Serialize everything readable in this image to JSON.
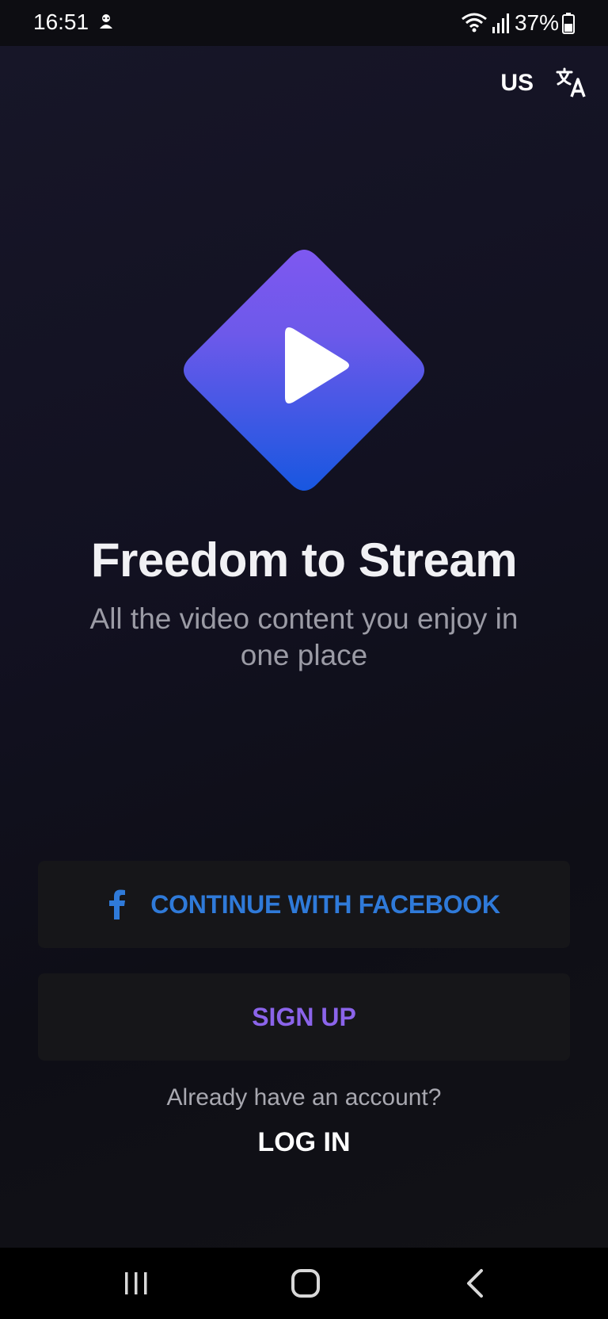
{
  "status_bar": {
    "time": "16:51",
    "battery": "37%"
  },
  "header": {
    "region": "US"
  },
  "hero": {
    "title": "Freedom to Stream",
    "subtitle": "All the video content you enjoy in one place"
  },
  "actions": {
    "facebook_label": "CONTINUE WITH FACEBOOK",
    "signup_label": "SIGN UP",
    "account_prompt": "Already have an account?",
    "login_label": "LOG IN"
  },
  "colors": {
    "facebook_blue": "#2f7ad9",
    "signup_purple": "#8b64ea",
    "logo_gradient_top": "#7e58f0",
    "logo_gradient_bottom": "#1857e0"
  }
}
